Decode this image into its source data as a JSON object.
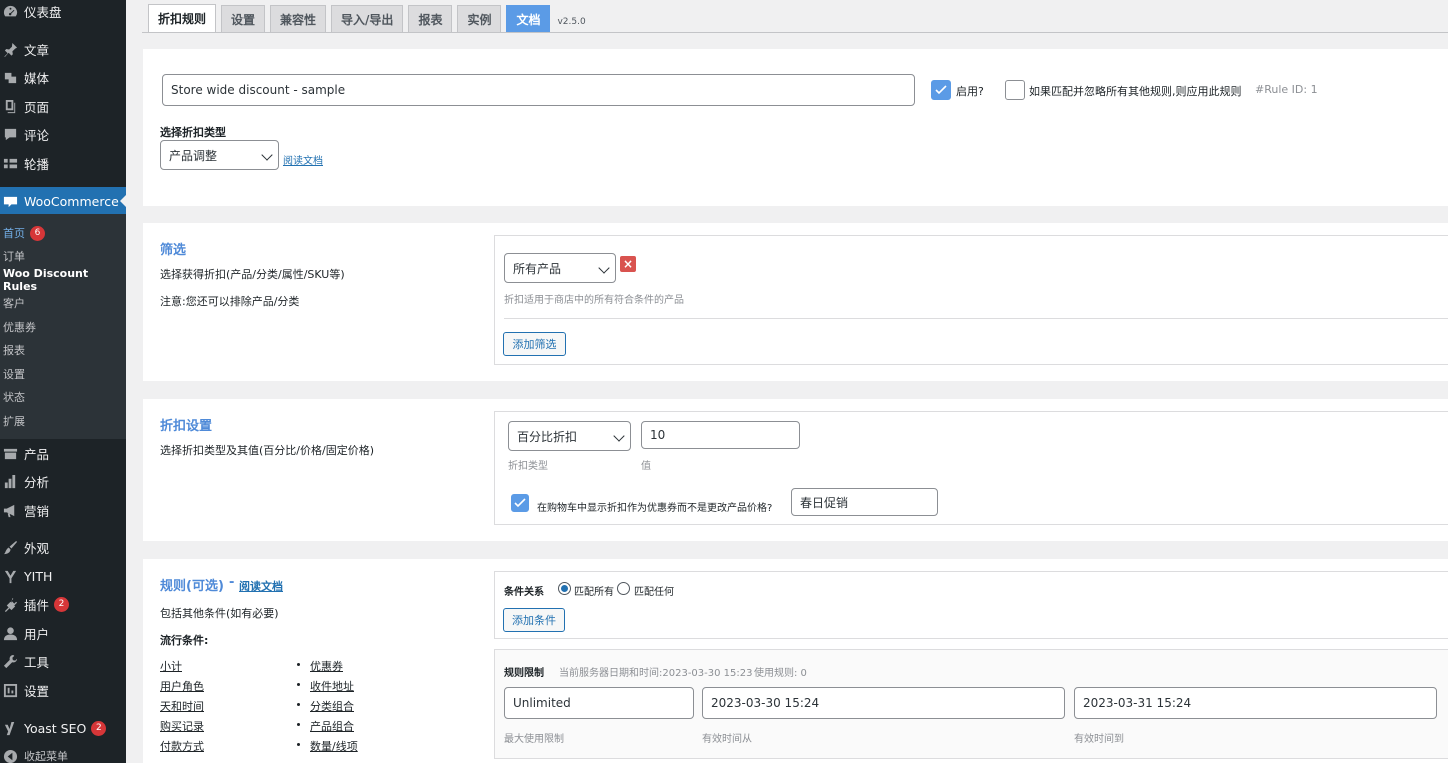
{
  "sidebar": {
    "top_items": [
      {
        "label": "仪表盘",
        "icon": "dashboard-icon"
      },
      {
        "label": "文章",
        "icon": "pin-icon"
      },
      {
        "label": "媒体",
        "icon": "media-icon"
      },
      {
        "label": "页面",
        "icon": "page-icon"
      },
      {
        "label": "评论",
        "icon": "comment-icon"
      },
      {
        "label": "轮播",
        "icon": "slider-icon"
      }
    ],
    "woocommerce": {
      "label": "WooCommerce",
      "icon": "woo-icon"
    },
    "submenu": [
      {
        "label": "首页",
        "badge": "6"
      },
      {
        "label": "订单"
      },
      {
        "label": "Woo Discount Rules"
      },
      {
        "label": "客户"
      },
      {
        "label": "优惠券"
      },
      {
        "label": "报表"
      },
      {
        "label": "设置"
      },
      {
        "label": "状态"
      },
      {
        "label": "扩展"
      }
    ],
    "bottom_items": [
      {
        "label": "产品",
        "icon": "product-icon"
      },
      {
        "label": "分析",
        "icon": "analytics-icon"
      },
      {
        "label": "营销",
        "icon": "megaphone-icon"
      },
      {
        "label": "外观",
        "icon": "brush-icon"
      },
      {
        "label": "YITH",
        "icon": "yith-icon"
      },
      {
        "label": "插件",
        "icon": "plugin-icon",
        "badge": "2"
      },
      {
        "label": "用户",
        "icon": "user-icon"
      },
      {
        "label": "工具",
        "icon": "wrench-icon"
      },
      {
        "label": "设置",
        "icon": "settings-icon"
      },
      {
        "label": "Yoast SEO",
        "icon": "yoast-icon",
        "badge": "2"
      },
      {
        "label": "收起菜单",
        "icon": "collapse-icon"
      }
    ]
  },
  "tabs": [
    "折扣规则",
    "设置",
    "兼容性",
    "导入/导出",
    "报表",
    "实例",
    "文档"
  ],
  "version": "v2.5.0",
  "rule": {
    "title_value": "Store wide discount - sample",
    "enabled_label": "启用?",
    "exclusive_label": "如果匹配并忽略所有其他规则,则应用此规则",
    "rule_id": "#Rule ID: 1",
    "discount_type_heading": "选择折扣类型",
    "discount_type_value": "产品调整",
    "read_docs": "阅读文档"
  },
  "filter": {
    "title": "筛选",
    "desc1": "选择获得折扣(产品/分类/属性/SKU等)",
    "desc2": "注意:您还可以排除产品/分类",
    "select_value": "所有产品",
    "hint": "折扣适用于商店中的所有符合条件的产品",
    "add_button": "添加筛选"
  },
  "discount": {
    "title": "折扣设置",
    "desc": "选择折扣类型及其值(百分比/价格/固定价格)",
    "type_value": "百分比折扣",
    "type_hint": "折扣类型",
    "amount_value": "10",
    "amount_hint": "值",
    "coupon_label": "在购物车中显示折扣作为优惠券而不是更改产品价格?",
    "coupon_value": "春日促销"
  },
  "rules": {
    "title": "规则(可选)",
    "dash": "-",
    "docs_link": "阅读文档",
    "desc": "包括其他条件(如有必要)",
    "popular_heading": "流行条件:",
    "conditions_left": [
      "小计",
      "用户角色",
      "天和时间",
      "购买记录",
      "付款方式"
    ],
    "conditions_right": [
      "优惠券",
      "收件地址",
      "分类组合",
      "产品组合",
      "数量/线项"
    ],
    "relation_label": "条件关系",
    "match_all": "匹配所有",
    "match_any": "匹配任何",
    "add_condition": "添加条件",
    "limit_label": "规则限制",
    "server_time": "当前服务器日期和时间:2023-03-30 15:23",
    "used": "使用规则: 0",
    "max_usage_value": "Unlimited",
    "max_usage_hint": "最大使用限制",
    "valid_from_value": "2023-03-30 15:24",
    "valid_from_hint": "有效时间从",
    "valid_to_value": "2023-03-31 15:24",
    "valid_to_hint": "有效时间到"
  }
}
